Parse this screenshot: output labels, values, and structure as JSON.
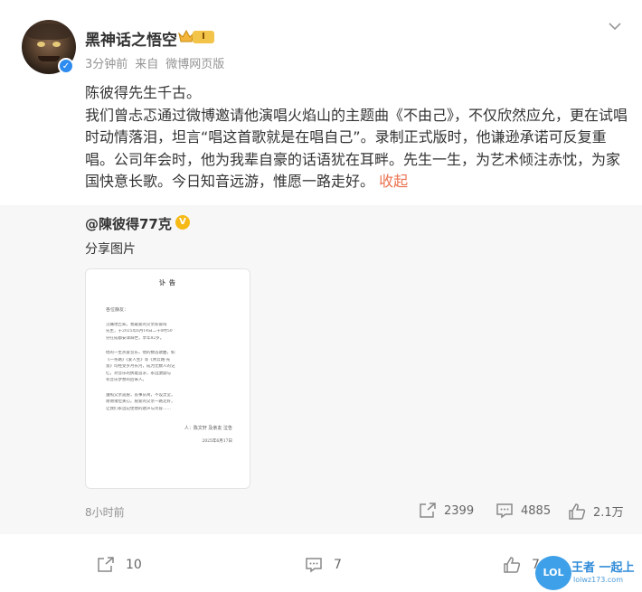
{
  "post": {
    "username": "黑神话之悟空",
    "level_badge": "I",
    "time": "3分钟前",
    "source_prefix": "来自",
    "source": "微博网页版",
    "text_line1": "陈彼得先生千古。",
    "text_body": "我们曾忐忑通过微博邀请他演唱火焰山的主题曲《不由己》，不仅欣然应允，更在试唱时动情落泪，坦言“唱这首歌就是在唱自己”。录制正式版时，他谦逊承诺可反复重唱。公司年会时，他为我辈自豪的话语犹在耳畔。先生一生，为艺术倾注赤忱，为家国快意长歌。今日知音远游，惟愿一路走好。",
    "collapse_label": "收起"
  },
  "repost": {
    "username": "@陳彼得77克",
    "share_label": "分享图片",
    "time": "8小时前",
    "reposts": "2399",
    "comments": "4885",
    "likes": "2.1万",
    "image_doc": {
      "title": "讣告",
      "greeting": "各位静友：",
      "para1": [
        "沉痛地告知，我最爱的父亲陈彼得",
        "先生，于2025年6月14日二十0时50",
        "分在成都安详辞世，享年82岁。"
      ],
      "para2": [
        "他的一生热爱音乐，他的数首歌曲，如",
        "《一条路》《爱人生》等《青云路·光",
        "景》均经受岁月长河，成为无数人的记",
        "忆，对音乐的执着追求，永远激励与",
        "有音乐梦想的后来人。"
      ],
      "para3": [
        "遵照父亲遗愿，丧事从简，不设灵堂，",
        "谢谢诸位关心。愿爱的父亲一路走好，",
        "让我们永远记住他的歌声与笑容……"
      ],
      "signature": "人：陈文轩 及亲友 泣告",
      "date": "2025年6月17日"
    }
  },
  "footer": {
    "reposts": "10",
    "comments": "7",
    "likes": "74"
  },
  "watermark": {
    "badge": "LOL",
    "title": "王者 一起上",
    "url": "lolwz173.com"
  },
  "colors": {
    "accent": "#eb7350",
    "verified_blue": "#2e8cf0",
    "gold": "#f6b916",
    "repost_bg": "#f7f7f7"
  }
}
